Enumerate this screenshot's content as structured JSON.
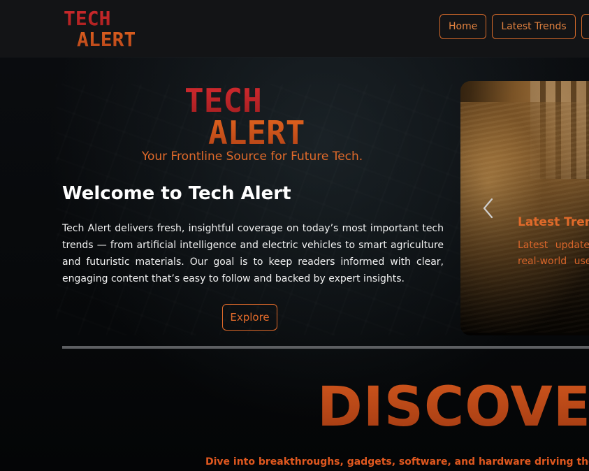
{
  "header": {
    "logo_line1": "TECH",
    "logo_line2": "ALERT",
    "nav": [
      {
        "label": "Home"
      },
      {
        "label": "Latest Trends"
      },
      {
        "label": ""
      }
    ]
  },
  "hero": {
    "logo_line1": "TECH",
    "logo_line2": "ALERT",
    "tagline": "Your Frontline Source for Future Tech.",
    "title": "Welcome to Tech Alert",
    "intro": "Tech Alert delivers fresh, insightful coverage on today’s most important tech trends — from artificial intelligence and electric vehicles to smart agriculture and futuristic materials. Our goal is to keep readers informed with clear, engaging content that’s easy to follow and backed by expert insights.",
    "explore_label": "Explore"
  },
  "carousel": {
    "title": "Latest Trenc",
    "text_line1": "Latest updates",
    "text_line2": "real-world uses",
    "prev_icon": "chevron-left-icon"
  },
  "discover": {
    "heading": "DISCOVER",
    "subheading": "Dive into breakthroughs, gadgets, software, and hardware driving the evolu"
  },
  "colors": {
    "accent": "#e06a2a",
    "logo_red": "#c8262b",
    "logo_orange": "#d45a1e",
    "header_bg": "#131416"
  }
}
